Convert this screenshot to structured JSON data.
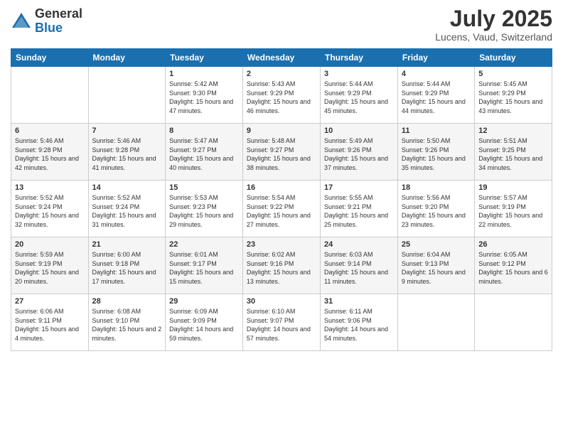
{
  "logo": {
    "general": "General",
    "blue": "Blue"
  },
  "title": "July 2025",
  "location": "Lucens, Vaud, Switzerland",
  "days_of_week": [
    "Sunday",
    "Monday",
    "Tuesday",
    "Wednesday",
    "Thursday",
    "Friday",
    "Saturday"
  ],
  "weeks": [
    [
      {
        "day": "",
        "info": ""
      },
      {
        "day": "",
        "info": ""
      },
      {
        "day": "1",
        "info": "Sunrise: 5:42 AM\nSunset: 9:30 PM\nDaylight: 15 hours and 47 minutes."
      },
      {
        "day": "2",
        "info": "Sunrise: 5:43 AM\nSunset: 9:29 PM\nDaylight: 15 hours and 46 minutes."
      },
      {
        "day": "3",
        "info": "Sunrise: 5:44 AM\nSunset: 9:29 PM\nDaylight: 15 hours and 45 minutes."
      },
      {
        "day": "4",
        "info": "Sunrise: 5:44 AM\nSunset: 9:29 PM\nDaylight: 15 hours and 44 minutes."
      },
      {
        "day": "5",
        "info": "Sunrise: 5:45 AM\nSunset: 9:29 PM\nDaylight: 15 hours and 43 minutes."
      }
    ],
    [
      {
        "day": "6",
        "info": "Sunrise: 5:46 AM\nSunset: 9:28 PM\nDaylight: 15 hours and 42 minutes."
      },
      {
        "day": "7",
        "info": "Sunrise: 5:46 AM\nSunset: 9:28 PM\nDaylight: 15 hours and 41 minutes."
      },
      {
        "day": "8",
        "info": "Sunrise: 5:47 AM\nSunset: 9:27 PM\nDaylight: 15 hours and 40 minutes."
      },
      {
        "day": "9",
        "info": "Sunrise: 5:48 AM\nSunset: 9:27 PM\nDaylight: 15 hours and 38 minutes."
      },
      {
        "day": "10",
        "info": "Sunrise: 5:49 AM\nSunset: 9:26 PM\nDaylight: 15 hours and 37 minutes."
      },
      {
        "day": "11",
        "info": "Sunrise: 5:50 AM\nSunset: 9:26 PM\nDaylight: 15 hours and 35 minutes."
      },
      {
        "day": "12",
        "info": "Sunrise: 5:51 AM\nSunset: 9:25 PM\nDaylight: 15 hours and 34 minutes."
      }
    ],
    [
      {
        "day": "13",
        "info": "Sunrise: 5:52 AM\nSunset: 9:24 PM\nDaylight: 15 hours and 32 minutes."
      },
      {
        "day": "14",
        "info": "Sunrise: 5:52 AM\nSunset: 9:24 PM\nDaylight: 15 hours and 31 minutes."
      },
      {
        "day": "15",
        "info": "Sunrise: 5:53 AM\nSunset: 9:23 PM\nDaylight: 15 hours and 29 minutes."
      },
      {
        "day": "16",
        "info": "Sunrise: 5:54 AM\nSunset: 9:22 PM\nDaylight: 15 hours and 27 minutes."
      },
      {
        "day": "17",
        "info": "Sunrise: 5:55 AM\nSunset: 9:21 PM\nDaylight: 15 hours and 25 minutes."
      },
      {
        "day": "18",
        "info": "Sunrise: 5:56 AM\nSunset: 9:20 PM\nDaylight: 15 hours and 23 minutes."
      },
      {
        "day": "19",
        "info": "Sunrise: 5:57 AM\nSunset: 9:19 PM\nDaylight: 15 hours and 22 minutes."
      }
    ],
    [
      {
        "day": "20",
        "info": "Sunrise: 5:59 AM\nSunset: 9:19 PM\nDaylight: 15 hours and 20 minutes."
      },
      {
        "day": "21",
        "info": "Sunrise: 6:00 AM\nSunset: 9:18 PM\nDaylight: 15 hours and 17 minutes."
      },
      {
        "day": "22",
        "info": "Sunrise: 6:01 AM\nSunset: 9:17 PM\nDaylight: 15 hours and 15 minutes."
      },
      {
        "day": "23",
        "info": "Sunrise: 6:02 AM\nSunset: 9:16 PM\nDaylight: 15 hours and 13 minutes."
      },
      {
        "day": "24",
        "info": "Sunrise: 6:03 AM\nSunset: 9:14 PM\nDaylight: 15 hours and 11 minutes."
      },
      {
        "day": "25",
        "info": "Sunrise: 6:04 AM\nSunset: 9:13 PM\nDaylight: 15 hours and 9 minutes."
      },
      {
        "day": "26",
        "info": "Sunrise: 6:05 AM\nSunset: 9:12 PM\nDaylight: 15 hours and 6 minutes."
      }
    ],
    [
      {
        "day": "27",
        "info": "Sunrise: 6:06 AM\nSunset: 9:11 PM\nDaylight: 15 hours and 4 minutes."
      },
      {
        "day": "28",
        "info": "Sunrise: 6:08 AM\nSunset: 9:10 PM\nDaylight: 15 hours and 2 minutes."
      },
      {
        "day": "29",
        "info": "Sunrise: 6:09 AM\nSunset: 9:09 PM\nDaylight: 14 hours and 59 minutes."
      },
      {
        "day": "30",
        "info": "Sunrise: 6:10 AM\nSunset: 9:07 PM\nDaylight: 14 hours and 57 minutes."
      },
      {
        "day": "31",
        "info": "Sunrise: 6:11 AM\nSunset: 9:06 PM\nDaylight: 14 hours and 54 minutes."
      },
      {
        "day": "",
        "info": ""
      },
      {
        "day": "",
        "info": ""
      }
    ]
  ]
}
